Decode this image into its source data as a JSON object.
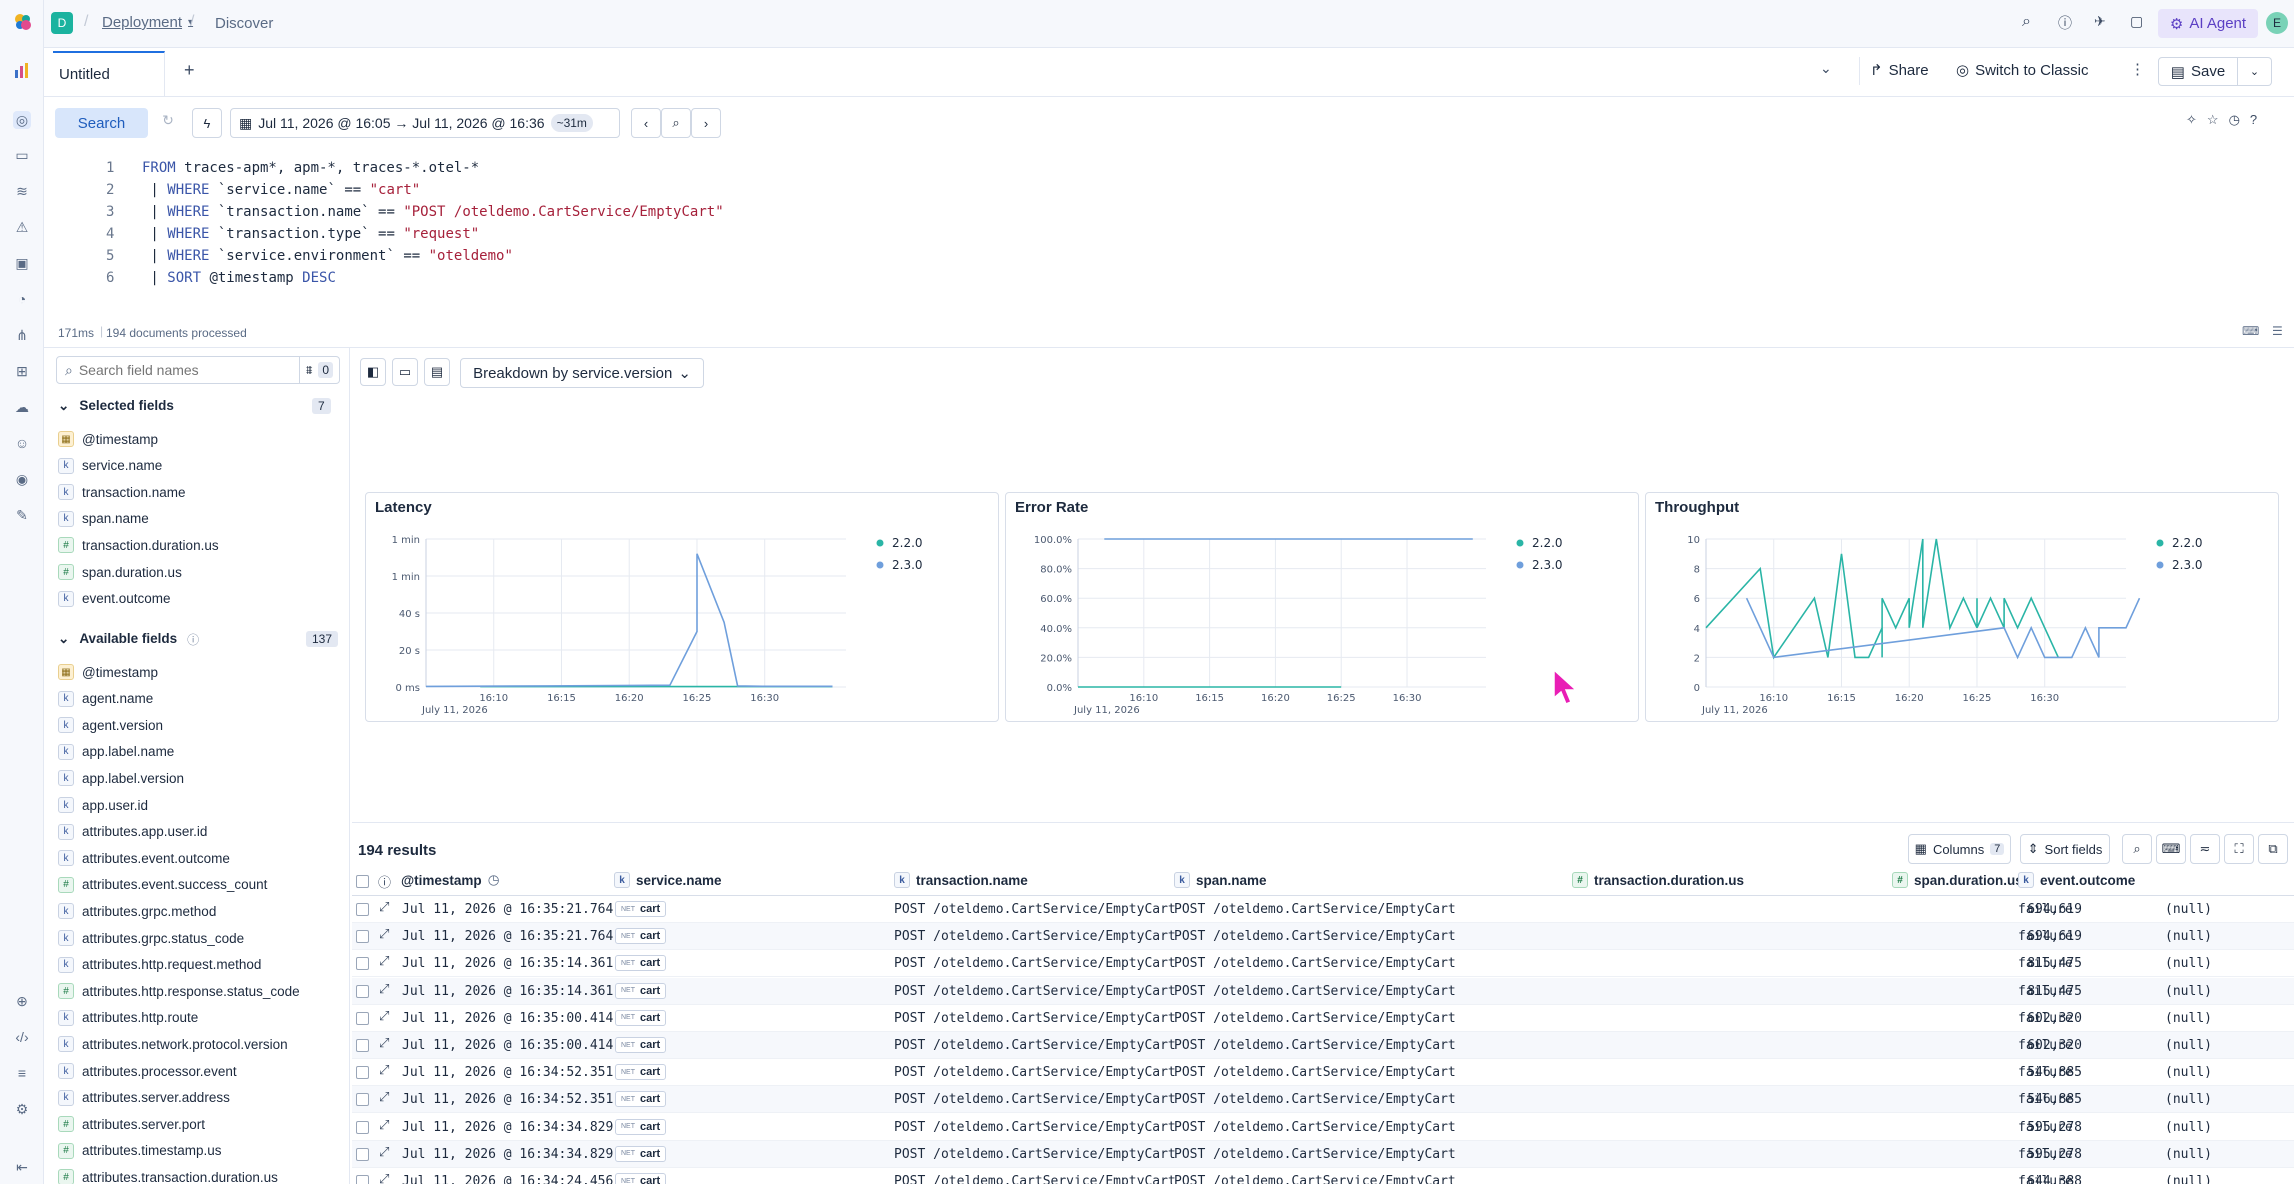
{
  "header": {
    "space_initial": "D",
    "deployment": "Deployment",
    "page": "Discover",
    "ai_agent": "AI Agent",
    "avatar_initial": "E"
  },
  "tabs": {
    "active": "Untitled",
    "share": "Share",
    "switch_classic": "Switch to Classic",
    "save": "Save"
  },
  "query_bar": {
    "search": "Search",
    "time_range": "Jul 11, 2026 @ 16:05 → Jul 11, 2026 @ 16:36",
    "duration_badge": "~31m"
  },
  "editor": {
    "lines": [
      {
        "n": "1",
        "parts": [
          {
            "t": "FROM",
            "c": "kw"
          },
          {
            "t": " traces-apm*, apm-*, traces-*.otel-*",
            "c": ""
          }
        ]
      },
      {
        "n": "2",
        "parts": [
          {
            "t": " | ",
            "c": ""
          },
          {
            "t": "WHERE",
            "c": "kw"
          },
          {
            "t": " `service.name` == ",
            "c": ""
          },
          {
            "t": "\"cart\"",
            "c": "str"
          }
        ]
      },
      {
        "n": "3",
        "parts": [
          {
            "t": " | ",
            "c": ""
          },
          {
            "t": "WHERE",
            "c": "kw"
          },
          {
            "t": " `transaction.name` == ",
            "c": ""
          },
          {
            "t": "\"POST /oteldemo.CartService/EmptyCart\"",
            "c": "str"
          }
        ]
      },
      {
        "n": "4",
        "parts": [
          {
            "t": " | ",
            "c": ""
          },
          {
            "t": "WHERE",
            "c": "kw"
          },
          {
            "t": " `transaction.type` == ",
            "c": ""
          },
          {
            "t": "\"request\"",
            "c": "str"
          }
        ]
      },
      {
        "n": "5",
        "parts": [
          {
            "t": " | ",
            "c": ""
          },
          {
            "t": "WHERE",
            "c": "kw"
          },
          {
            "t": " `service.environment` == ",
            "c": ""
          },
          {
            "t": "\"oteldemo\"",
            "c": "str"
          }
        ]
      },
      {
        "n": "6",
        "parts": [
          {
            "t": " | ",
            "c": ""
          },
          {
            "t": "SORT",
            "c": "kw"
          },
          {
            "t": " @timestamp ",
            "c": ""
          },
          {
            "t": "DESC",
            "c": "kw"
          }
        ]
      }
    ],
    "status_time": "171ms",
    "status_docs": "194 documents processed"
  },
  "sidebar": {
    "search_placeholder": "Search field names",
    "filter_count": "0",
    "selected_title": "Selected fields",
    "selected_count": "7",
    "selected": [
      {
        "name": "@timestamp",
        "type": "d"
      },
      {
        "name": "service.name",
        "type": "k"
      },
      {
        "name": "transaction.name",
        "type": "k"
      },
      {
        "name": "span.name",
        "type": "k"
      },
      {
        "name": "transaction.duration.us",
        "type": "n"
      },
      {
        "name": "span.duration.us",
        "type": "n"
      },
      {
        "name": "event.outcome",
        "type": "k"
      }
    ],
    "available_title": "Available fields",
    "available_count": "137",
    "available": [
      {
        "name": "@timestamp",
        "type": "d"
      },
      {
        "name": "agent.name",
        "type": "k"
      },
      {
        "name": "agent.version",
        "type": "k"
      },
      {
        "name": "app.label.name",
        "type": "k"
      },
      {
        "name": "app.label.version",
        "type": "k"
      },
      {
        "name": "app.user.id",
        "type": "k"
      },
      {
        "name": "attributes.app.user.id",
        "type": "k"
      },
      {
        "name": "attributes.event.outcome",
        "type": "k"
      },
      {
        "name": "attributes.event.success_count",
        "type": "n"
      },
      {
        "name": "attributes.grpc.method",
        "type": "k"
      },
      {
        "name": "attributes.grpc.status_code",
        "type": "k"
      },
      {
        "name": "attributes.http.request.method",
        "type": "k"
      },
      {
        "name": "attributes.http.response.status_code",
        "type": "n"
      },
      {
        "name": "attributes.http.route",
        "type": "k"
      },
      {
        "name": "attributes.network.protocol.version",
        "type": "k"
      },
      {
        "name": "attributes.processor.event",
        "type": "k"
      },
      {
        "name": "attributes.server.address",
        "type": "k"
      },
      {
        "name": "attributes.server.port",
        "type": "n"
      },
      {
        "name": "attributes.timestamp.us",
        "type": "n"
      },
      {
        "name": "attributes.transaction.duration.us",
        "type": "n"
      }
    ]
  },
  "breakdown": "Breakdown by service.version",
  "chart_data": [
    {
      "type": "line",
      "title": "Latency",
      "x_ticks": [
        "16:10",
        "16:15",
        "16:20",
        "16:25",
        "16:30"
      ],
      "x_date": "July 11, 2026",
      "y_ticks": [
        "0 ms",
        "20 s",
        "40 s",
        "1 min",
        "1 min"
      ],
      "ylim": [
        0,
        80
      ],
      "series": [
        {
          "name": "2.2.0",
          "color": "#2ab5a6",
          "points": [
            [
              16.09,
              0.2
            ],
            [
              16.35,
              0.2
            ]
          ]
        },
        {
          "name": "2.3.0",
          "color": "#6f9fdc",
          "points": [
            [
              16.05,
              0.3
            ],
            [
              16.14,
              0.6
            ],
            [
              16.19,
              0.8
            ],
            [
              16.235,
              1
            ],
            [
              16.245,
              30
            ],
            [
              16.255,
              72
            ],
            [
              16.265,
              35
            ],
            [
              16.28,
              0.6
            ],
            [
              16.3,
              0.4
            ],
            [
              16.35,
              0.4
            ]
          ]
        }
      ]
    },
    {
      "type": "line",
      "title": "Error Rate",
      "x_ticks": [
        "16:10",
        "16:15",
        "16:20",
        "16:25",
        "16:30"
      ],
      "x_date": "July 11, 2026",
      "y_ticks": [
        "0.0%",
        "20.0%",
        "40.0%",
        "60.0%",
        "80.0%",
        "100.0%"
      ],
      "ylim": [
        0,
        100
      ],
      "series": [
        {
          "name": "2.2.0",
          "color": "#2ab5a6",
          "points": [
            [
              16.05,
              0
            ],
            [
              16.255,
              0
            ]
          ]
        },
        {
          "name": "2.3.0",
          "color": "#6f9fdc",
          "points": [
            [
              16.07,
              100
            ],
            [
              16.35,
              100
            ]
          ]
        }
      ]
    },
    {
      "type": "line",
      "title": "Throughput",
      "x_ticks": [
        "16:10",
        "16:15",
        "16:20",
        "16:25",
        "16:30"
      ],
      "x_date": "July 11, 2026",
      "y_ticks": [
        "0",
        "2",
        "4",
        "6",
        "8",
        "10"
      ],
      "ylim": [
        0,
        10
      ],
      "series": [
        {
          "name": "2.2.0",
          "color": "#2ab5a6",
          "points": [
            [
              16.05,
              4
            ],
            [
              16.095,
              8
            ],
            [
              16.1,
              2
            ],
            [
              16.13,
              6
            ],
            [
              16.14,
              2
            ],
            [
              16.15,
              9
            ],
            [
              16.155,
              2
            ],
            [
              16.17,
              2
            ],
            [
              16.175,
              4
            ],
            [
              16.18,
              2
            ],
            [
              16.185,
              6
            ],
            [
              16.19,
              4
            ],
            [
              16.2,
              6
            ],
            [
              16.205,
              4
            ],
            [
              16.21,
              10
            ],
            [
              16.215,
              4
            ],
            [
              16.22,
              10
            ],
            [
              16.23,
              4
            ],
            [
              16.24,
              6
            ],
            [
              16.245,
              4
            ],
            [
              16.25,
              6
            ],
            [
              16.255,
              4
            ],
            [
              16.26,
              6
            ],
            [
              16.265,
              4
            ],
            [
              16.275,
              6
            ],
            [
              16.28,
              4
            ],
            [
              16.29,
              6
            ],
            [
              16.3,
              4
            ],
            [
              16.31,
              2
            ]
          ]
        },
        {
          "name": "2.3.0",
          "color": "#6f9fdc",
          "points": [
            [
              16.08,
              6
            ],
            [
              16.09,
              4
            ],
            [
              16.1,
              2
            ],
            [
              16.27,
              4
            ],
            [
              16.28,
              2
            ],
            [
              16.29,
              4
            ],
            [
              16.3,
              2
            ],
            [
              16.32,
              2
            ],
            [
              16.33,
              4
            ],
            [
              16.34,
              2
            ],
            [
              16.345,
              4
            ],
            [
              16.36,
              4
            ],
            [
              16.37,
              6
            ]
          ]
        }
      ]
    }
  ],
  "results": {
    "count": "194 results",
    "columns_btn": "Columns",
    "columns_count": "7",
    "sort_btn": "Sort fields",
    "headers": [
      "@timestamp",
      "service.name",
      "transaction.name",
      "span.name",
      "transaction.duration.us",
      "span.duration.us",
      "event.outcome"
    ],
    "rows": [
      {
        "ts": "Jul 11, 2026 @ 16:35:21.764",
        "svc": "cart",
        "agent": "NET",
        "txn": "POST /oteldemo.CartService/EmptyCart",
        "span": "POST /oteldemo.CartService/EmptyCart",
        "dur": "694,619",
        "sdur": "(null)",
        "outcome": "failure"
      },
      {
        "ts": "Jul 11, 2026 @ 16:35:21.764",
        "svc": "cart",
        "agent": "NET",
        "txn": "POST /oteldemo.CartService/EmptyCart",
        "span": "POST /oteldemo.CartService/EmptyCart",
        "dur": "694,619",
        "sdur": "(null)",
        "outcome": "failure"
      },
      {
        "ts": "Jul 11, 2026 @ 16:35:14.361",
        "svc": "cart",
        "agent": "NET",
        "txn": "POST /oteldemo.CartService/EmptyCart",
        "span": "POST /oteldemo.CartService/EmptyCart",
        "dur": "815,475",
        "sdur": "(null)",
        "outcome": "failure"
      },
      {
        "ts": "Jul 11, 2026 @ 16:35:14.361",
        "svc": "cart",
        "agent": "NET",
        "txn": "POST /oteldemo.CartService/EmptyCart",
        "span": "POST /oteldemo.CartService/EmptyCart",
        "dur": "815,475",
        "sdur": "(null)",
        "outcome": "failure"
      },
      {
        "ts": "Jul 11, 2026 @ 16:35:00.414",
        "svc": "cart",
        "agent": "NET",
        "txn": "POST /oteldemo.CartService/EmptyCart",
        "span": "POST /oteldemo.CartService/EmptyCart",
        "dur": "602,320",
        "sdur": "(null)",
        "outcome": "failure"
      },
      {
        "ts": "Jul 11, 2026 @ 16:35:00.414",
        "svc": "cart",
        "agent": "NET",
        "txn": "POST /oteldemo.CartService/EmptyCart",
        "span": "POST /oteldemo.CartService/EmptyCart",
        "dur": "602,320",
        "sdur": "(null)",
        "outcome": "failure"
      },
      {
        "ts": "Jul 11, 2026 @ 16:34:52.351",
        "svc": "cart",
        "agent": "NET",
        "txn": "POST /oteldemo.CartService/EmptyCart",
        "span": "POST /oteldemo.CartService/EmptyCart",
        "dur": "546,885",
        "sdur": "(null)",
        "outcome": "failure"
      },
      {
        "ts": "Jul 11, 2026 @ 16:34:52.351",
        "svc": "cart",
        "agent": "NET",
        "txn": "POST /oteldemo.CartService/EmptyCart",
        "span": "POST /oteldemo.CartService/EmptyCart",
        "dur": "546,885",
        "sdur": "(null)",
        "outcome": "failure"
      },
      {
        "ts": "Jul 11, 2026 @ 16:34:34.829",
        "svc": "cart",
        "agent": "NET",
        "txn": "POST /oteldemo.CartService/EmptyCart",
        "span": "POST /oteldemo.CartService/EmptyCart",
        "dur": "595,278",
        "sdur": "(null)",
        "outcome": "failure"
      },
      {
        "ts": "Jul 11, 2026 @ 16:34:34.829",
        "svc": "cart",
        "agent": "NET",
        "txn": "POST /oteldemo.CartService/EmptyCart",
        "span": "POST /oteldemo.CartService/EmptyCart",
        "dur": "595,278",
        "sdur": "(null)",
        "outcome": "failure"
      },
      {
        "ts": "Jul 11, 2026 @ 16:34:24.456",
        "svc": "cart",
        "agent": "NET",
        "txn": "POST /oteldemo.CartService/EmptyCart",
        "span": "POST /oteldemo.CartService/EmptyCart",
        "dur": "644,388",
        "sdur": "(null)",
        "outcome": "failure"
      }
    ]
  }
}
